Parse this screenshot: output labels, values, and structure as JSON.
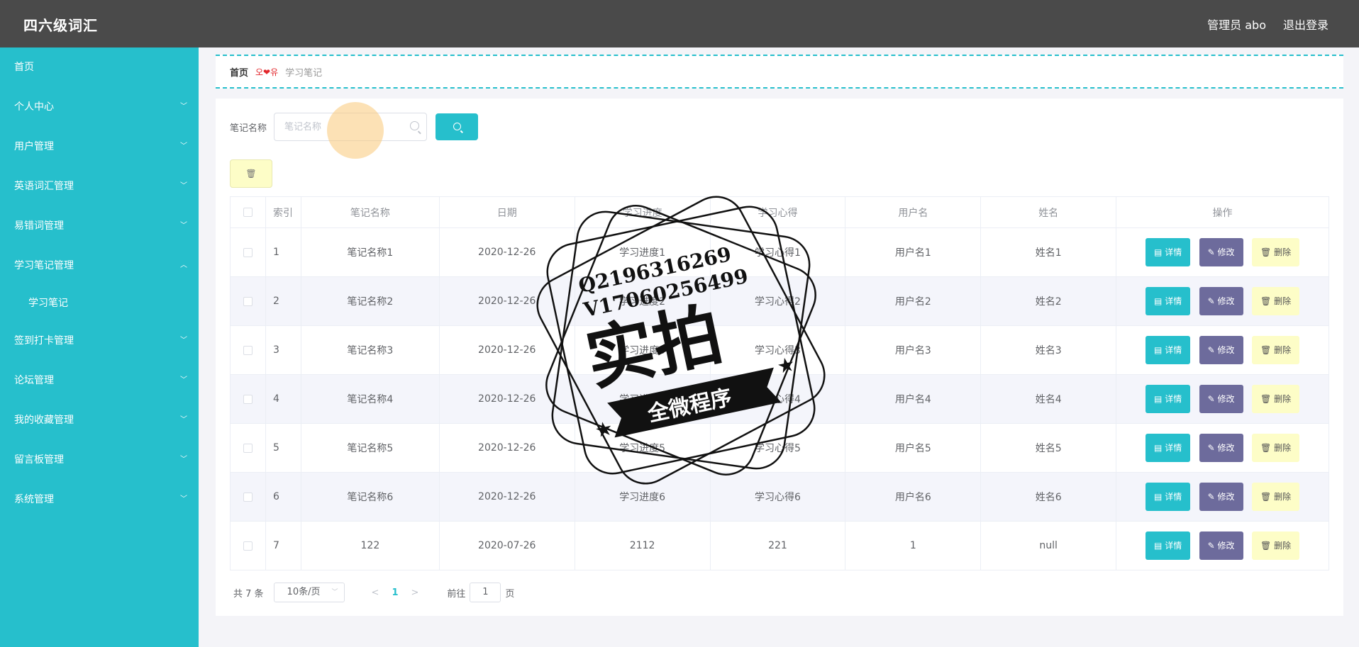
{
  "header": {
    "title": "四六级词汇",
    "user": "管理员 abo",
    "logout": "退出登录"
  },
  "sidebar": {
    "items": [
      {
        "label": "首页"
      },
      {
        "label": "个人中心"
      },
      {
        "label": "用户管理"
      },
      {
        "label": "英语词汇管理"
      },
      {
        "label": "易错词管理"
      },
      {
        "label": "学习笔记管理"
      },
      {
        "label": "学习笔记"
      },
      {
        "label": "签到打卡管理"
      },
      {
        "label": "论坛管理"
      },
      {
        "label": "我的收藏管理"
      },
      {
        "label": "留言板管理"
      },
      {
        "label": "系统管理"
      }
    ]
  },
  "breadcrumb": {
    "home": "首页",
    "sep": "오❤유",
    "current": "学习笔记"
  },
  "search": {
    "label": "笔记名称",
    "placeholder": "笔记名称"
  },
  "table": {
    "headers": [
      "索引",
      "笔记名称",
      "日期",
      "学习进度",
      "学习心得",
      "用户名",
      "姓名",
      "操作"
    ],
    "rows": [
      [
        "1",
        "笔记名称1",
        "2020-12-26",
        "学习进度1",
        "学习心得1",
        "用户名1",
        "姓名1"
      ],
      [
        "2",
        "笔记名称2",
        "2020-12-26",
        "学习进度2",
        "学习心得2",
        "用户名2",
        "姓名2"
      ],
      [
        "3",
        "笔记名称3",
        "2020-12-26",
        "学习进度3",
        "学习心得3",
        "用户名3",
        "姓名3"
      ],
      [
        "4",
        "笔记名称4",
        "2020-12-26",
        "学习进度4",
        "学习心得4",
        "用户名4",
        "姓名4"
      ],
      [
        "5",
        "笔记名称5",
        "2020-12-26",
        "学习进度5",
        "学习心得5",
        "用户名5",
        "姓名5"
      ],
      [
        "6",
        "笔记名称6",
        "2020-12-26",
        "学习进度6",
        "学习心得6",
        "用户名6",
        "姓名6"
      ],
      [
        "7",
        "122",
        "2020-07-26",
        "2112",
        "221",
        "1",
        "null"
      ]
    ],
    "actions": {
      "detail": "详情",
      "edit": "修改",
      "delete": "删除"
    }
  },
  "pagination": {
    "total": "共 7 条",
    "page_size": "10条/页",
    "current": "1",
    "goto_prefix": "前往",
    "goto_value": "1",
    "goto_suffix": "页"
  },
  "watermark": {
    "line1": "Q2196316269",
    "line2": "V17060256499",
    "big": "实拍",
    "banner": "全微程序"
  },
  "colors": {
    "accent": "#26bfcc",
    "header": "#4a4a4a",
    "edit": "#6d6b9c",
    "delete": "#fdfdc7"
  }
}
